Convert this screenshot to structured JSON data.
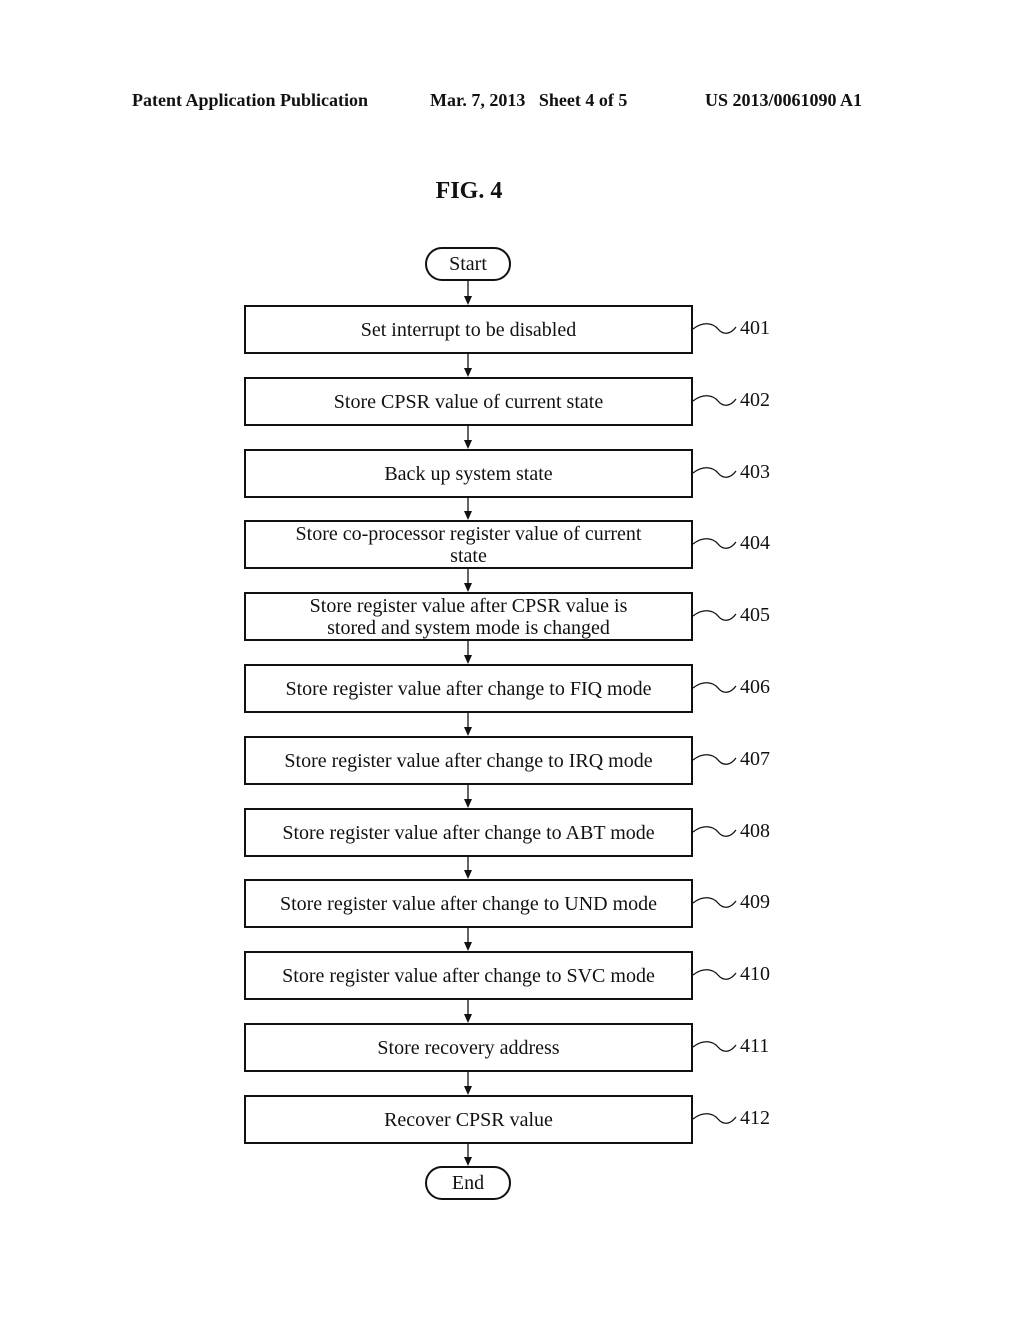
{
  "header": {
    "left": "Patent Application Publication",
    "middle": "Mar. 7, 2013   Sheet 4 of 5",
    "right": "US 2013/0061090 A1"
  },
  "figure": {
    "title": "FIG. 4",
    "start_label": "Start",
    "end_label": "End",
    "steps": [
      {
        "ref": "401",
        "text": "Set interrupt to be disabled"
      },
      {
        "ref": "402",
        "text": "Store CPSR value of current state"
      },
      {
        "ref": "403",
        "text": "Back up system state"
      },
      {
        "ref": "404",
        "text": "Store co-processor register value of current state"
      },
      {
        "ref": "405",
        "text": "Store register value after CPSR value is stored and system mode is changed"
      },
      {
        "ref": "406",
        "text": "Store register value after change to FIQ mode"
      },
      {
        "ref": "407",
        "text": "Store register value after change to IRQ mode"
      },
      {
        "ref": "408",
        "text": "Store register value after change to ABT mode"
      },
      {
        "ref": "409",
        "text": "Store register value after change to UND mode"
      },
      {
        "ref": "410",
        "text": "Store register value after change to SVC mode"
      },
      {
        "ref": "411",
        "text": "Store recovery address"
      },
      {
        "ref": "412",
        "text": "Recover CPSR value"
      }
    ]
  }
}
